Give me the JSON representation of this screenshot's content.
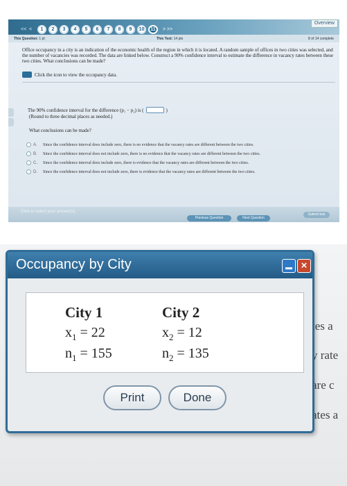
{
  "quiz": {
    "overview_label": "Overview",
    "nav": {
      "prev_symbols": [
        "<<",
        "<"
      ],
      "dots": [
        "1",
        "2",
        "3",
        "4",
        "5",
        "6",
        "7",
        "8",
        "9",
        "10",
        "11"
      ],
      "current_dot": "11",
      "next_symbols": ">  >>"
    },
    "info": {
      "question_label": "This Question:",
      "question_value": "1 pt",
      "test_label": "This Test:",
      "test_value": "14 pts",
      "complete_text": "8 of 14 complete"
    },
    "question_text": "Office occupancy in a city is an indication of the economic health of the region in which it is located. A random sample of offices in two cities was selected, and the number of vacancies was recorded. The data are linked below. Construct a 90% confidence interval to estimate the difference in vacancy rates between these two cities. What conclusions can be made?",
    "data_link_text": "Click the icon to view the occupancy data.",
    "ci_prompt": "The 90% confidence interval for the difference (p₁ − p₂) is (",
    "ci_close": ")",
    "round_note": "(Round to three decimal places as needed.)",
    "conclusions_prompt": "What conclusions can be made?",
    "options": [
      {
        "letter": "A.",
        "text": "Since the confidence interval does include zero, there is no evidence that the vacancy rates are different between the two cities."
      },
      {
        "letter": "B.",
        "text": "Since the confidence interval does not include zero, there is no evidence that the vacancy rates are different between the two cities."
      },
      {
        "letter": "C.",
        "text": "Since the confidence interval does include zero, there is evidence that the vacancy rates are different between the two cities."
      },
      {
        "letter": "D.",
        "text": "Since the confidence interval does not include zero, there is evidence that the vacancy rates are different between the two cities."
      }
    ],
    "select_hint": "Click to select your answer(s).",
    "prev_button": "Previous Question",
    "next_button": "Next Question",
    "submit_button": "Submit test"
  },
  "dialog": {
    "title": "Occupancy by City",
    "city1": {
      "header": "City 1",
      "x_label": "x",
      "x_sub": "1",
      "x_value": "= 22",
      "n_label": "n",
      "n_sub": "1",
      "n_value": "= 155"
    },
    "city2": {
      "header": "City 2",
      "x_label": "x",
      "x_sub": "2",
      "x_value": "= 12",
      "n_label": "n",
      "n_sub": "2",
      "n_value": "= 135"
    },
    "print_button": "Print",
    "done_button": "Done"
  },
  "background_fragments": [
    "tes a",
    "y rate",
    "are c",
    "ates a"
  ]
}
